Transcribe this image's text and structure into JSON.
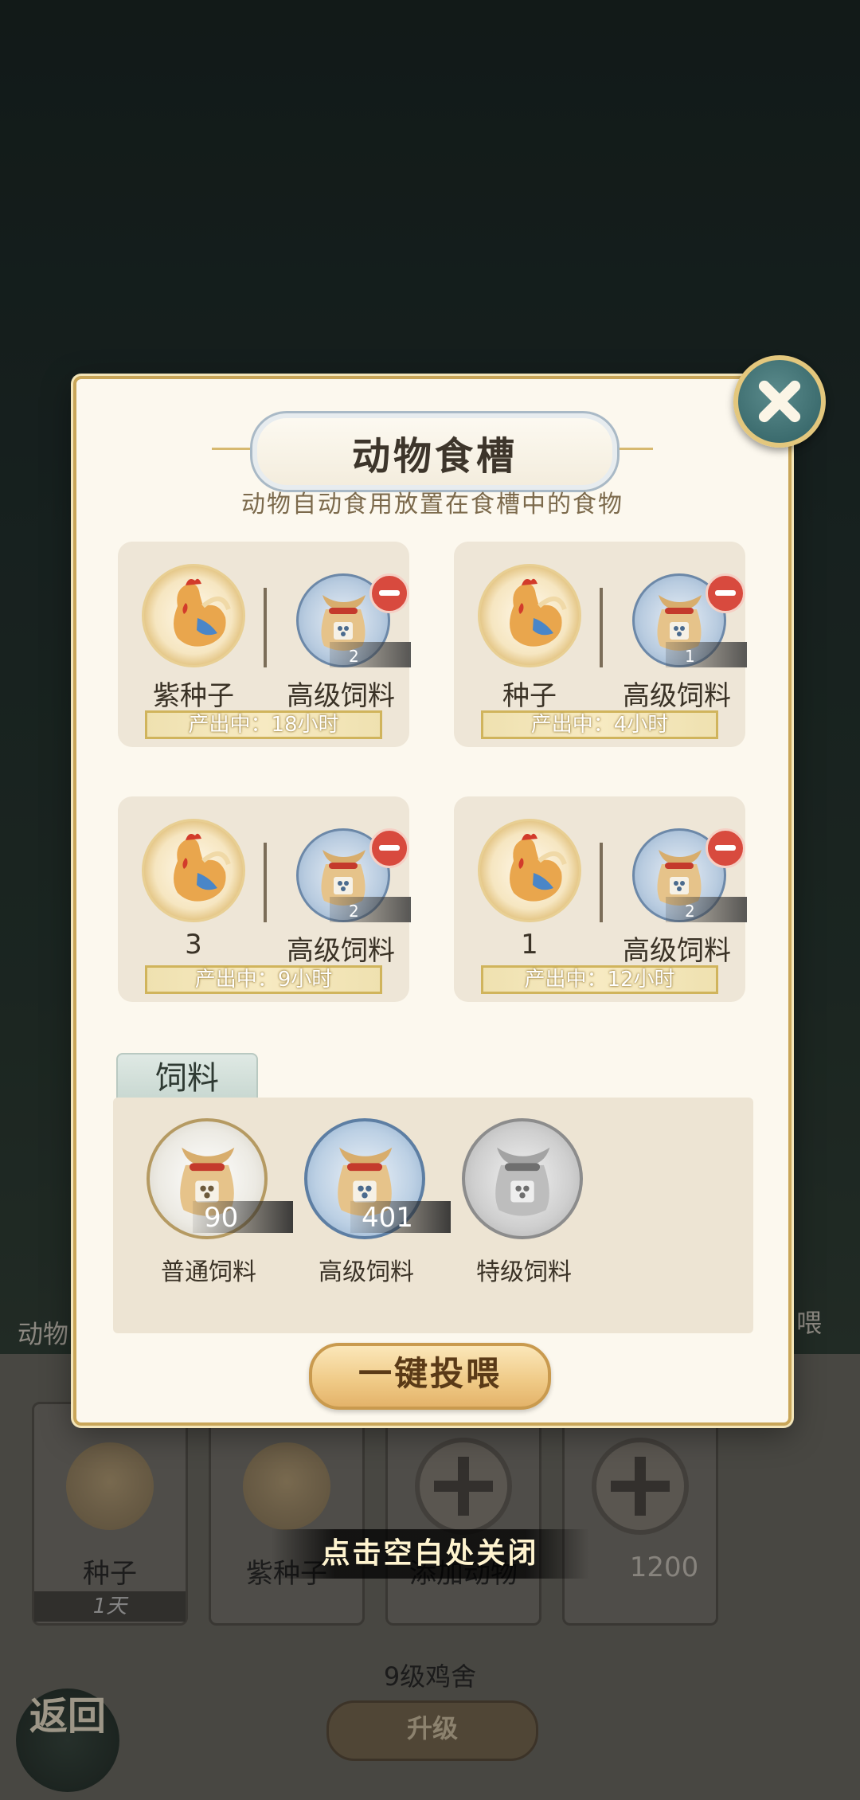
{
  "dialog": {
    "title": "动物食槽",
    "subtitle": "动物自动食用放置在食槽中的食物",
    "troughs": [
      {
        "animal": "紫种子",
        "feed": "高级饲料",
        "count": "2",
        "status": "产出中：18小时"
      },
      {
        "animal": "种子",
        "feed": "高级饲料",
        "count": "1",
        "status": "产出中：4小时"
      },
      {
        "animal": "3",
        "feed": "高级饲料",
        "count": "2",
        "status": "产出中：9小时"
      },
      {
        "animal": "1",
        "feed": "高级饲料",
        "count": "2",
        "status": "产出中：12小时"
      }
    ],
    "feed_section": {
      "tab": "饲料",
      "items": [
        {
          "name": "普通饲料",
          "qty": "90"
        },
        {
          "name": "高级饲料",
          "qty": "401"
        },
        {
          "name": "特级饲料",
          "qty": ""
        }
      ]
    },
    "feed_all_button": "一键投喂"
  },
  "background": {
    "left_label": "动物",
    "right_label": "喂",
    "cards": [
      {
        "label": "种子",
        "sub": "1天"
      },
      {
        "label": "紫种子"
      },
      {
        "label": "添加动物"
      }
    ],
    "coins": "1200",
    "coop_level": "9级鸡舍",
    "upgrade_button": "升级",
    "back_button": "返回",
    "close_hint": "点击空白处关闭"
  },
  "colors": {
    "dialog_bg": "#fcf8ee",
    "gold_border": "#c9a659",
    "close_button": "#3f7073",
    "minus_badge": "#d84a3e"
  },
  "icons": {
    "close": "close-x-icon",
    "animal": "rooster-icon",
    "feed": "feed-sack-icon",
    "remove": "minus-icon"
  }
}
